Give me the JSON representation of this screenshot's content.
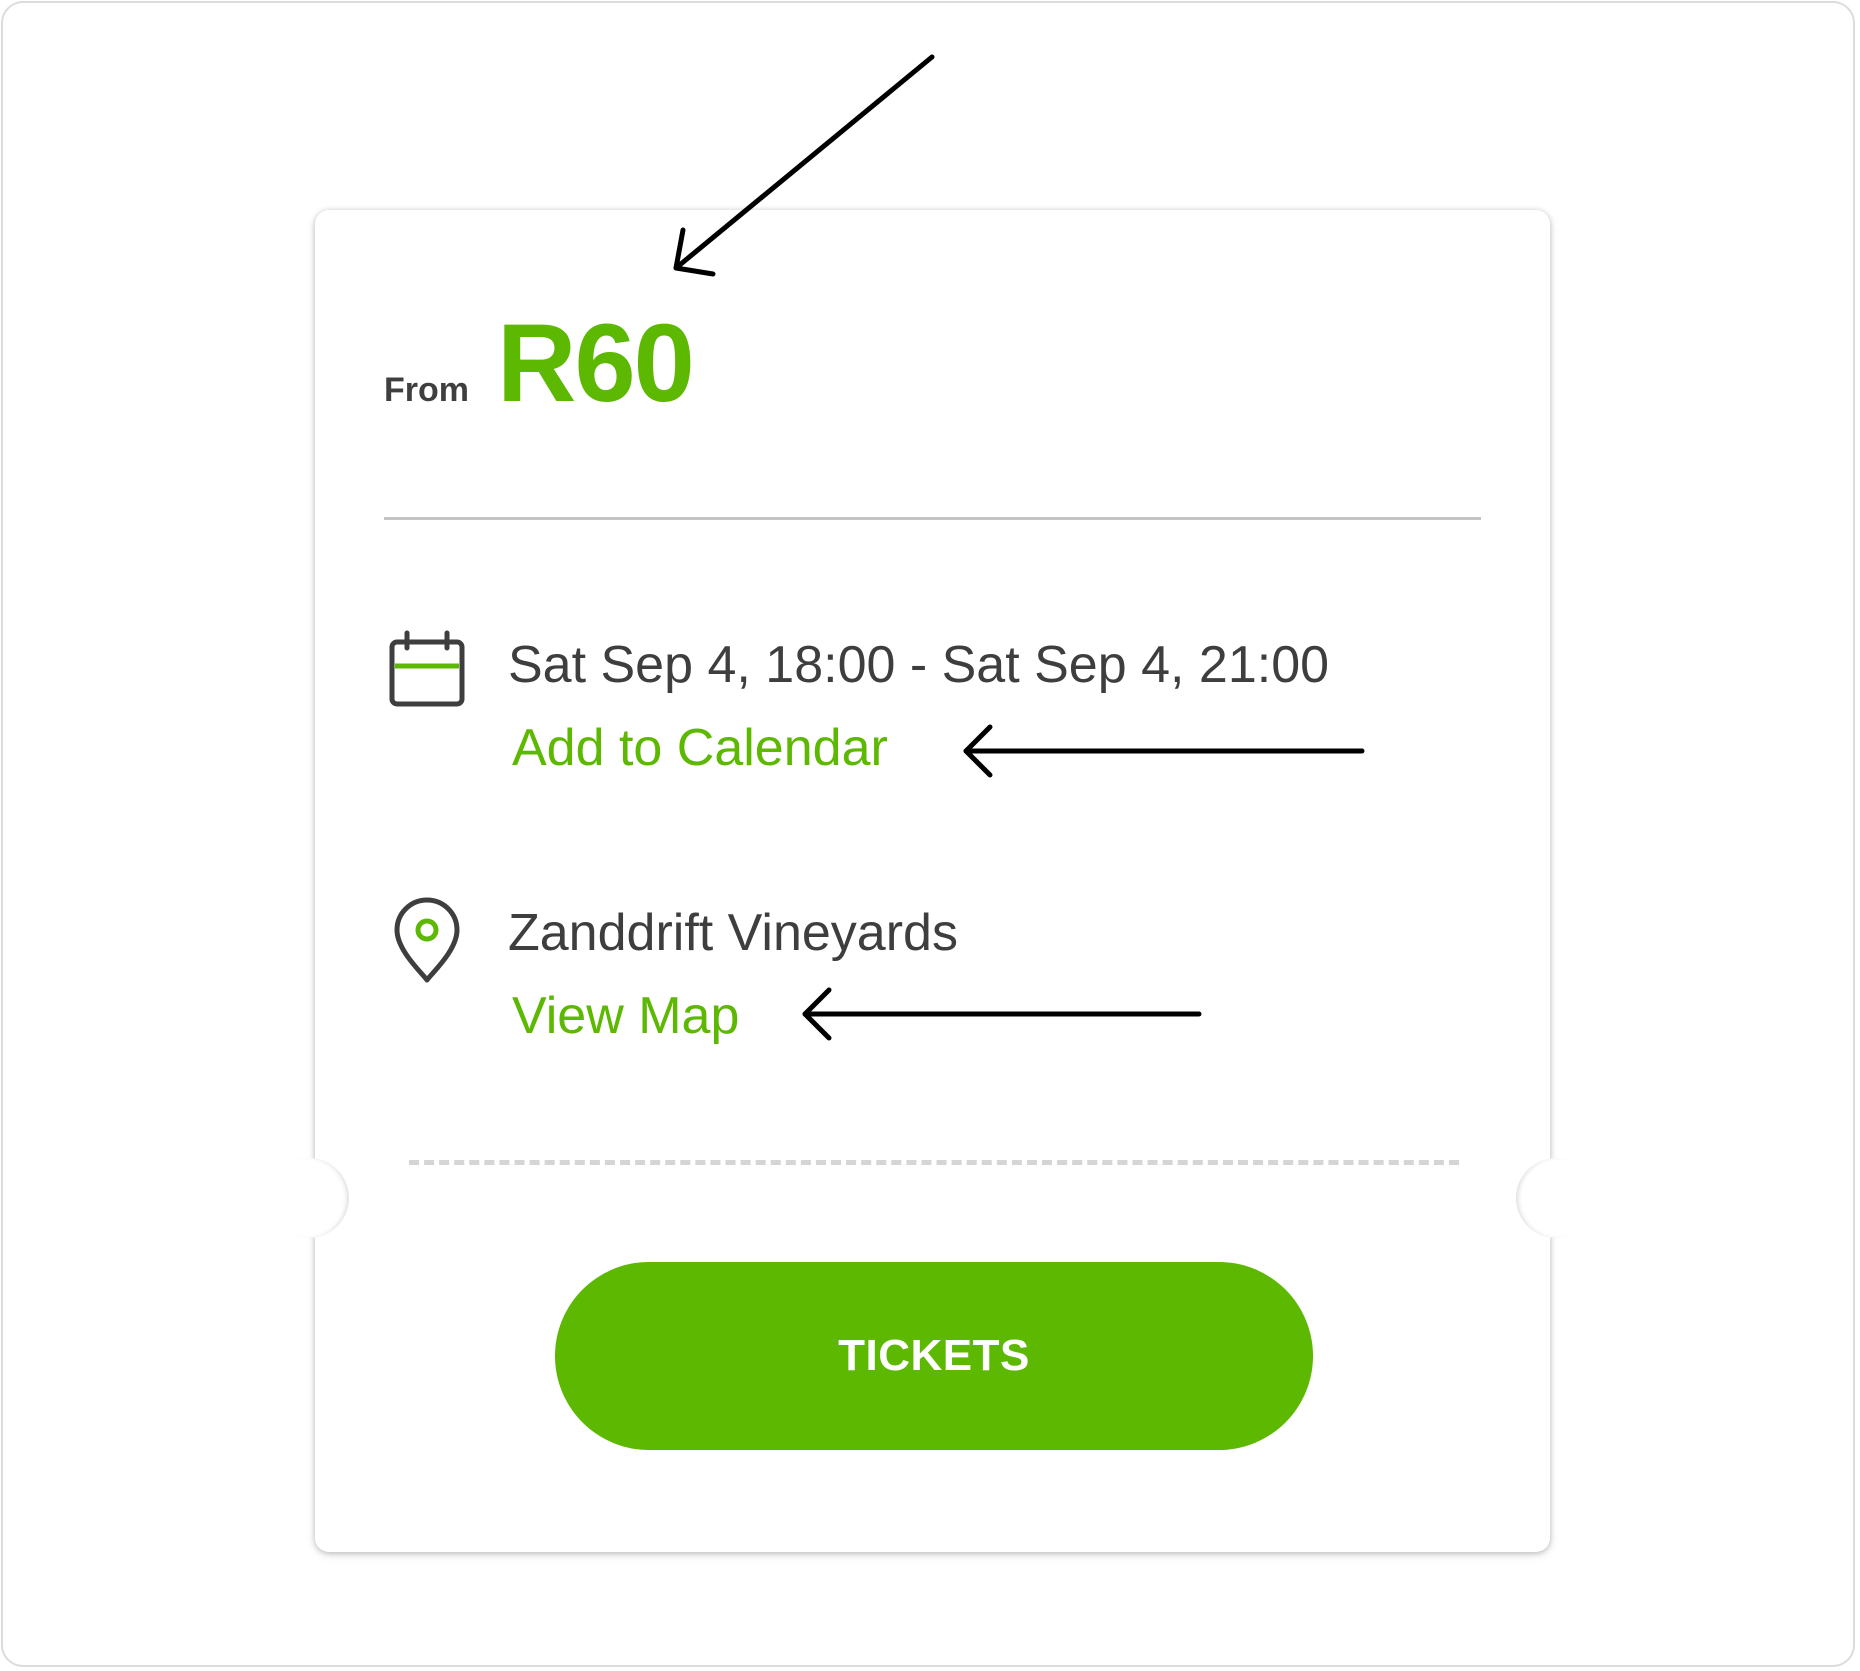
{
  "price": {
    "from_label": "From",
    "amount": "R60"
  },
  "event": {
    "datetime": "Sat Sep 4, 18:00 - Sat Sep 4, 21:00",
    "add_to_calendar_label": "Add to Calendar",
    "venue": "Zanddrift Vineyards",
    "view_map_label": "View Map"
  },
  "actions": {
    "tickets_label": "TICKETS"
  },
  "icons": {
    "date": "calendar-icon",
    "venue": "map-pin-icon"
  },
  "colors": {
    "accent": "#5cb800",
    "text": "#3e3e3e",
    "annotation": "#000000"
  }
}
